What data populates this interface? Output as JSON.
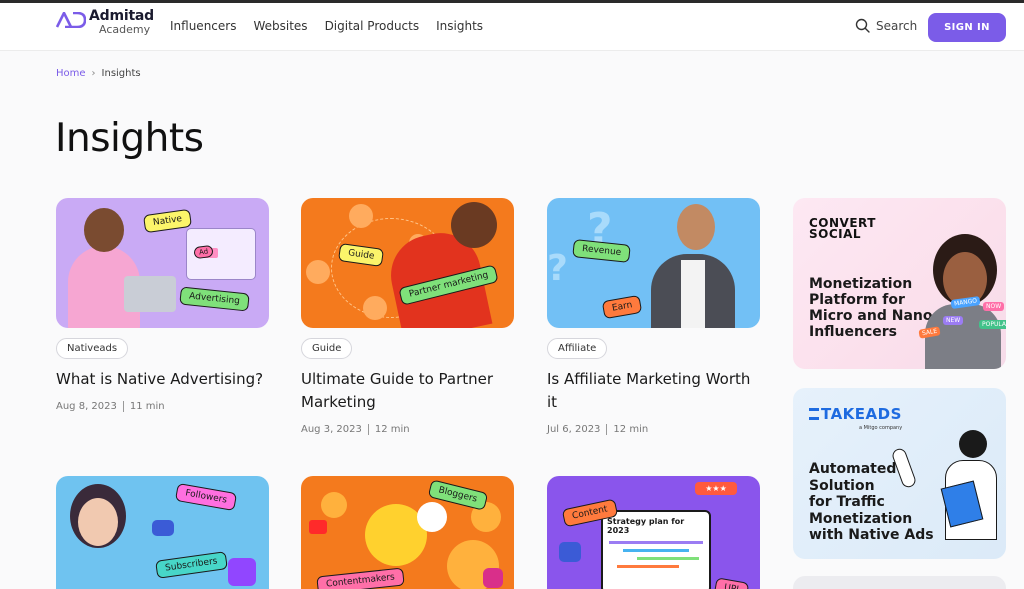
{
  "header": {
    "logo_name": "Admitad",
    "logo_sub": "Academy",
    "nav": [
      "Influencers",
      "Websites",
      "Digital Products",
      "Insights"
    ],
    "search_label": "Search",
    "signin_label": "SIGN IN"
  },
  "breadcrumb": {
    "home": "Home",
    "separator": "›",
    "current": "Insights"
  },
  "page_title": "Insights",
  "cards": [
    {
      "tag": "Nativeads",
      "title": "What is Native Advertising?",
      "date": "Aug 8, 2023",
      "read": "11 min",
      "chips": [
        "Native",
        "Ad",
        "Advertising"
      ]
    },
    {
      "tag": "Guide",
      "title": "Ultimate Guide to Partner Marketing",
      "date": "Aug 3, 2023",
      "read": "12 min",
      "chips": [
        "Guide",
        "Partner marketing"
      ]
    },
    {
      "tag": "Affiliate",
      "title": "Is Affiliate Marketing Worth it",
      "date": "Jul 6, 2023",
      "read": "12 min",
      "chips": [
        "Revenue",
        "Earn"
      ]
    }
  ],
  "row2": [
    {
      "chips": [
        "Followers",
        "Subscribers"
      ]
    },
    {
      "chips": [
        "Bloggers",
        "Contentmakers"
      ]
    },
    {
      "chips": [
        "Content",
        "UPI"
      ],
      "board_title": "Strategy plan for 2023"
    }
  ],
  "ads": [
    {
      "brand": "CONVERT\nSOCIAL",
      "title": "Monetization\nPlatform for\nMicro and Nano\nInfluencers",
      "chips": [
        "MANGO",
        "NOW",
        "POPULAR",
        "SALE",
        "NEW"
      ]
    },
    {
      "brand": "TAKEADS",
      "brand_sub": "a Mitgo company",
      "title": "Automated\nSolution\nfor Traffic\nMonetization\nwith Native Ads"
    }
  ],
  "colors": {
    "accent": "#7b5ce8",
    "card1": "#c7a7f3",
    "card2": "#f47a1d",
    "card3": "#6fbdf4"
  }
}
